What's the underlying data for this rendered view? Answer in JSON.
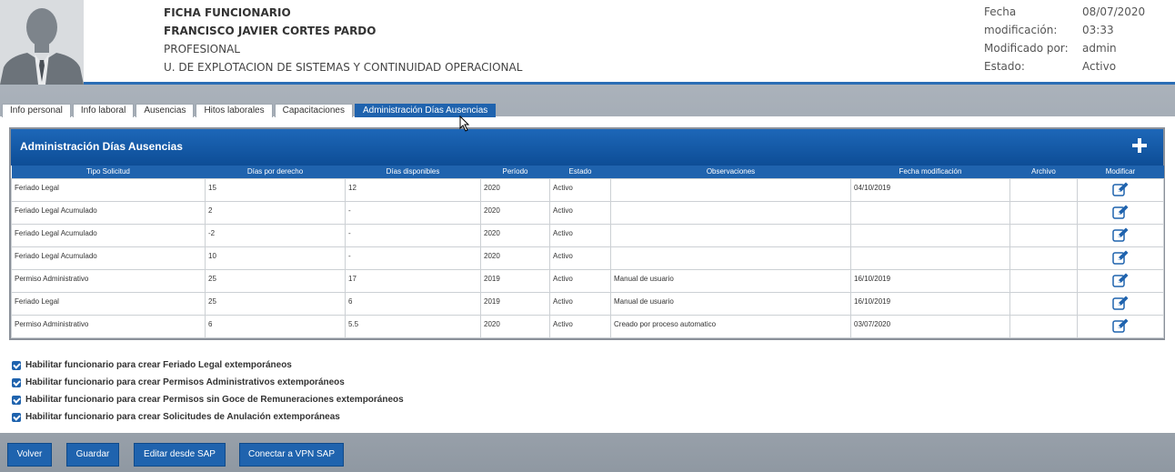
{
  "header": {
    "title": "FICHA FUNCIONARIO",
    "name": "FRANCISCO JAVIER CORTES PARDO",
    "role": "PROFESIONAL",
    "unit": "U. DE EXPLOTACION DE SISTEMAS Y CONTINUIDAD OPERACIONAL",
    "meta": {
      "fecha_label_1": "Fecha",
      "fecha_label_2": "modificación:",
      "fecha_date": "08/07/2020",
      "fecha_time": "03:33",
      "modificado_label": "Modificado por:",
      "modificado_value": "admin",
      "estado_label": "Estado:",
      "estado_value": "Activo"
    }
  },
  "tabs": [
    "Info personal",
    "Info laboral",
    "Ausencias",
    "Hitos laborales",
    "Capacitaciones",
    "Administración Días Ausencias"
  ],
  "active_tab": "Administración Días Ausencias",
  "panel": {
    "title": "Administración Días Ausencias",
    "columns": [
      "Tipo Solicitud",
      "Días por derecho",
      "Días disponibles",
      "Período",
      "Estado",
      "Observaciones",
      "Fecha modificación",
      "Archivo",
      "Modificar"
    ],
    "rows": [
      [
        "Feriado Legal",
        "15",
        "12",
        "2020",
        "Activo",
        "",
        "04/10/2019",
        ""
      ],
      [
        "Feriado Legal Acumulado",
        "2",
        "-",
        "2020",
        "Activo",
        "",
        "",
        ""
      ],
      [
        "Feriado Legal Acumulado",
        "-2",
        "-",
        "2020",
        "Activo",
        "",
        "",
        ""
      ],
      [
        "Feriado Legal Acumulado",
        "10",
        "-",
        "2020",
        "Activo",
        "",
        "",
        ""
      ],
      [
        "Permiso Administrativo",
        "25",
        "17",
        "2019",
        "Activo",
        "Manual de usuario",
        "16/10/2019",
        ""
      ],
      [
        "Feriado Legal",
        "25",
        "6",
        "2019",
        "Activo",
        "Manual de usuario",
        "16/10/2019",
        ""
      ],
      [
        "Permiso Administrativo",
        "6",
        "5.5",
        "2020",
        "Activo",
        "Creado por proceso automatico",
        "03/07/2020",
        ""
      ]
    ]
  },
  "checkboxes": [
    {
      "label": "Habilitar funcionario para crear Feriado Legal extemporáneos",
      "checked": true
    },
    {
      "label": "Habilitar funcionario para crear Permisos Administrativos extemporáneos",
      "checked": true
    },
    {
      "label": "Habilitar funcionario para crear Permisos sin Goce de Remuneraciones extemporáneos",
      "checked": true
    },
    {
      "label": "Habilitar funcionario para crear Solicitudes de Anulación extemporáneas",
      "checked": true
    }
  ],
  "buttons": {
    "volver": "Volver",
    "guardar": "Guardar",
    "editar_sap": "Editar desde SAP",
    "vpn_sap": "Conectar a VPN SAP"
  },
  "colors": {
    "accent": "#1f63ae",
    "header_border": "#2a6db5"
  }
}
